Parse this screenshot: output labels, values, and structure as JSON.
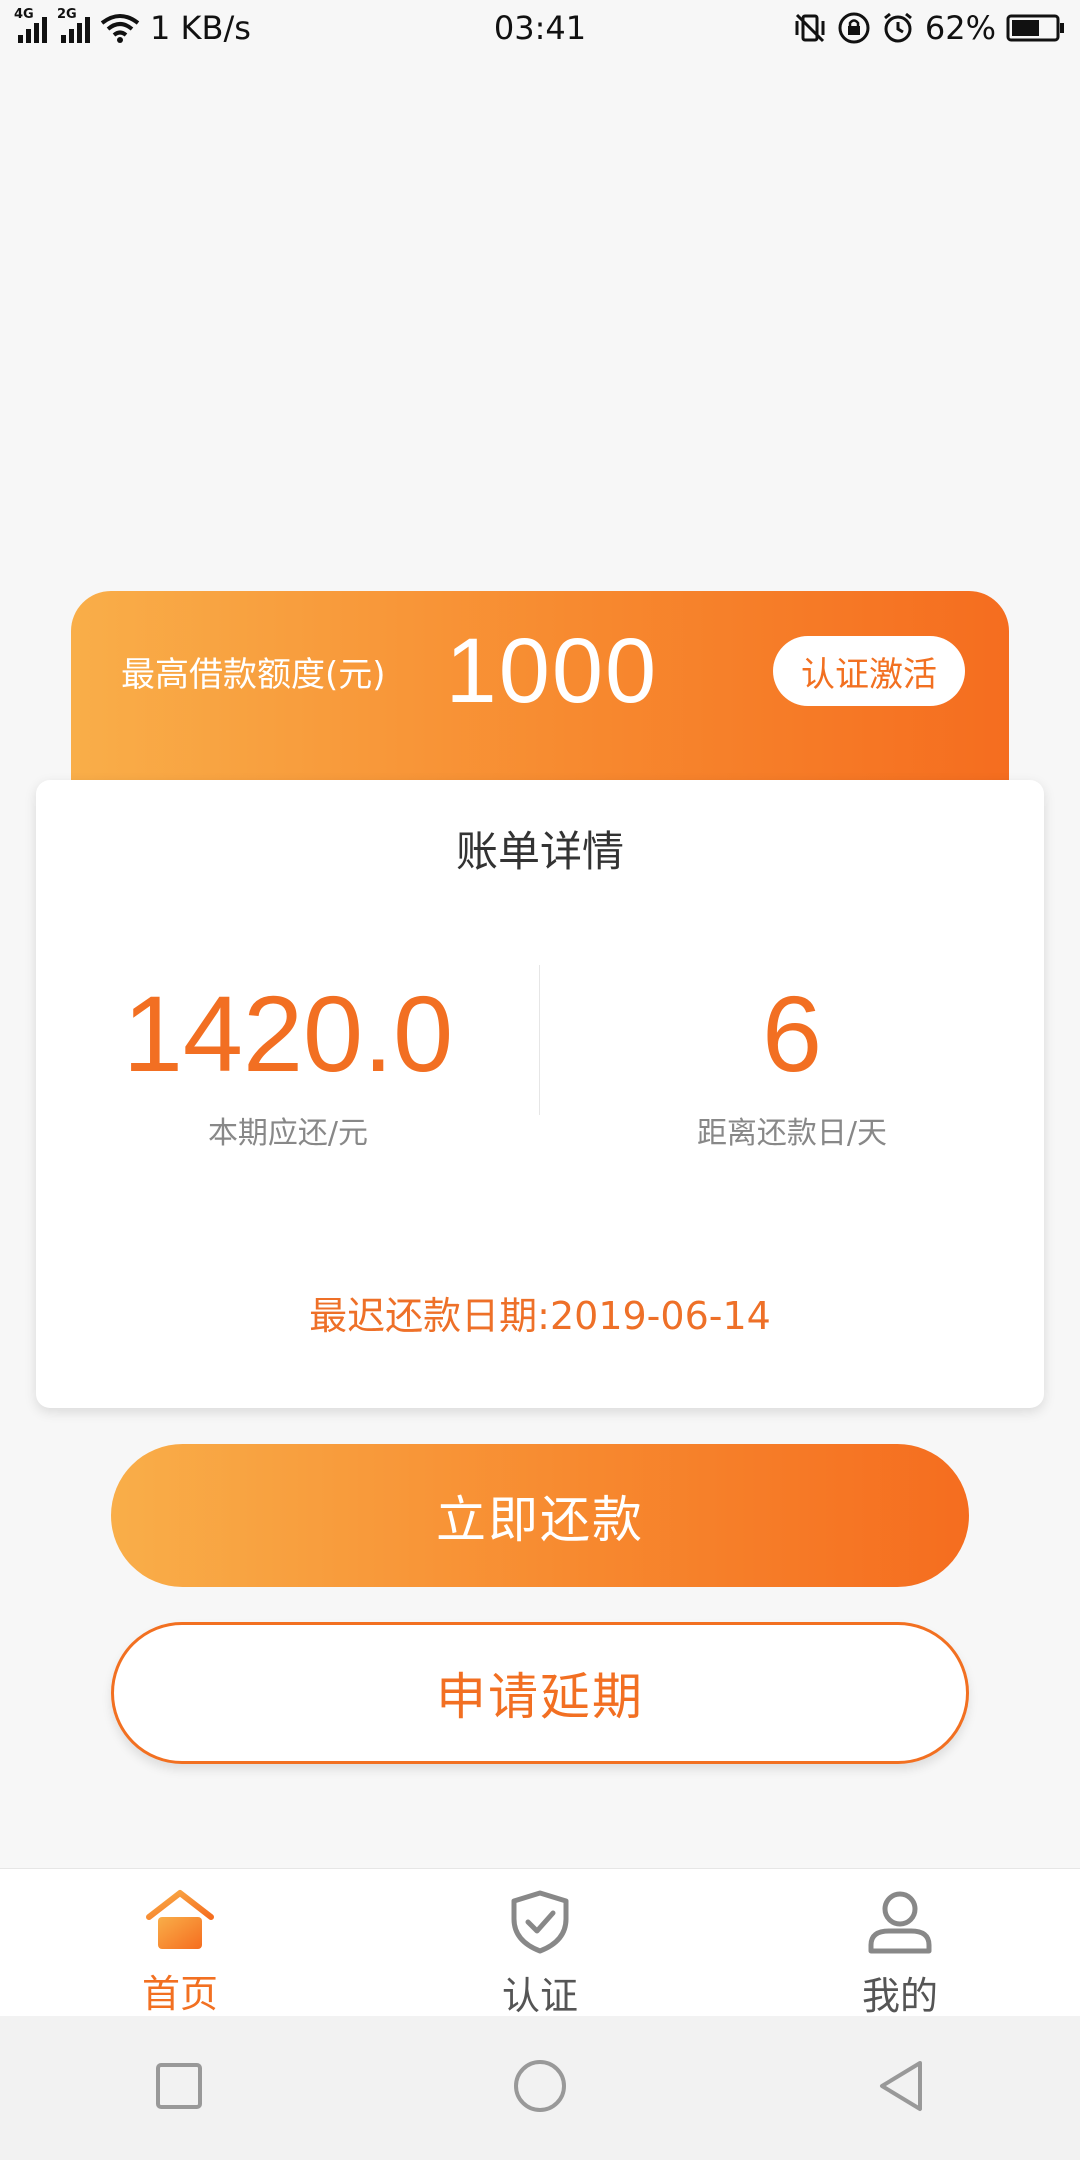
{
  "status_bar": {
    "net_speed": "1 KB/s",
    "time": "03:41",
    "battery": "62%",
    "sim1_type": "4G",
    "sim2_type": "2G"
  },
  "limit_card": {
    "label": "最高借款额度(元)",
    "value": "1000",
    "activate_button": "认证激活"
  },
  "bill": {
    "title": "账单详情",
    "amount_due": "1420.0",
    "amount_due_label": "本期应还/元",
    "days_left": "6",
    "days_left_label": "距离还款日/天",
    "due_date_text": "最迟还款日期:2019-06-14"
  },
  "actions": {
    "repay": "立即还款",
    "extend": "申请延期"
  },
  "tabs": [
    {
      "label": "首页",
      "icon": "home-icon",
      "active": true
    },
    {
      "label": "认证",
      "icon": "shield-check-icon",
      "active": false
    },
    {
      "label": "我的",
      "icon": "user-icon",
      "active": false
    }
  ],
  "colors": {
    "accent": "#f27021",
    "gradient_start": "#f9ae49",
    "gradient_end": "#f56d1f"
  }
}
